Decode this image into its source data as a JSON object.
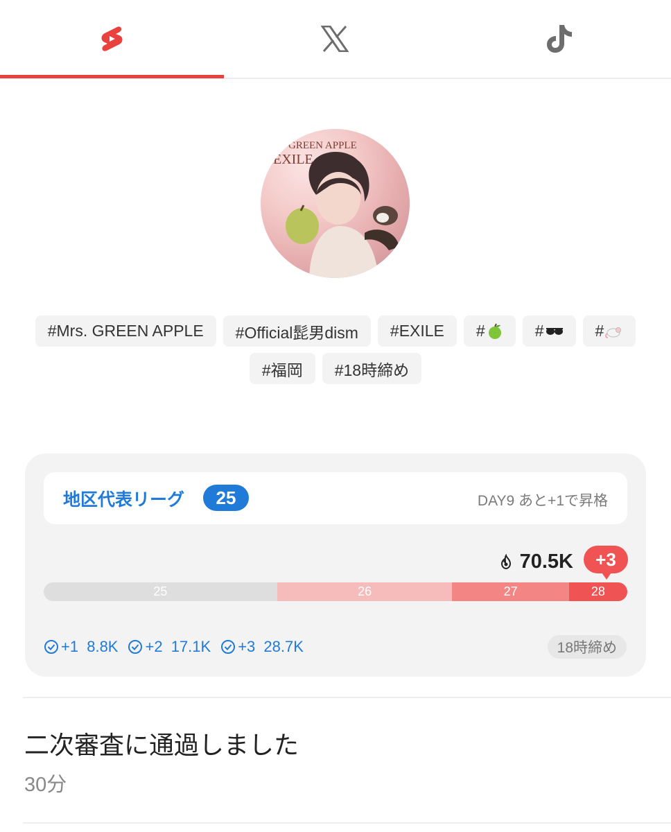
{
  "tabs": [
    {
      "name": "shorts",
      "icon": "youtube-shorts-icon",
      "active": true
    },
    {
      "name": "x",
      "icon": "x-icon",
      "active": false
    },
    {
      "name": "tiktok",
      "icon": "tiktok-icon",
      "active": false
    }
  ],
  "accent_color": "#e8413e",
  "link_color": "#1f7ad8",
  "avatar": {
    "text_line1": "GREEN APPLE",
    "text_line2": "EXILE"
  },
  "tags": [
    {
      "label": "#Mrs. GREEN APPLE"
    },
    {
      "label": "#Official髭男dism"
    },
    {
      "label": "#EXILE"
    },
    {
      "label": "#",
      "icon": "green-apple-icon"
    },
    {
      "label": "#",
      "icon": "sunglasses-icon"
    },
    {
      "label": "#",
      "icon": "rat-icon"
    },
    {
      "label": "#福岡"
    },
    {
      "label": "#18時締め"
    }
  ],
  "league": {
    "title": "地区代表リーグ",
    "badge": "25",
    "status": "DAY9 あと+1で昇格",
    "score": "70.5K",
    "rank_change": "+3",
    "segments": [
      {
        "label": "25",
        "share": 0.4,
        "color": "#dedede"
      },
      {
        "label": "26",
        "share": 0.3,
        "color": "#f6bcbc"
      },
      {
        "label": "27",
        "share": 0.2,
        "color": "#f48585"
      },
      {
        "label": "28",
        "share": 0.1,
        "color": "#ef5353"
      }
    ],
    "thresholds": [
      {
        "label": "+1",
        "value": "8.8K"
      },
      {
        "label": "+2",
        "value": "17.1K"
      },
      {
        "label": "+3",
        "value": "28.7K"
      }
    ],
    "deadline": "18時締め"
  },
  "notice": {
    "title": "二次審査に通過しました",
    "time": "30分"
  }
}
